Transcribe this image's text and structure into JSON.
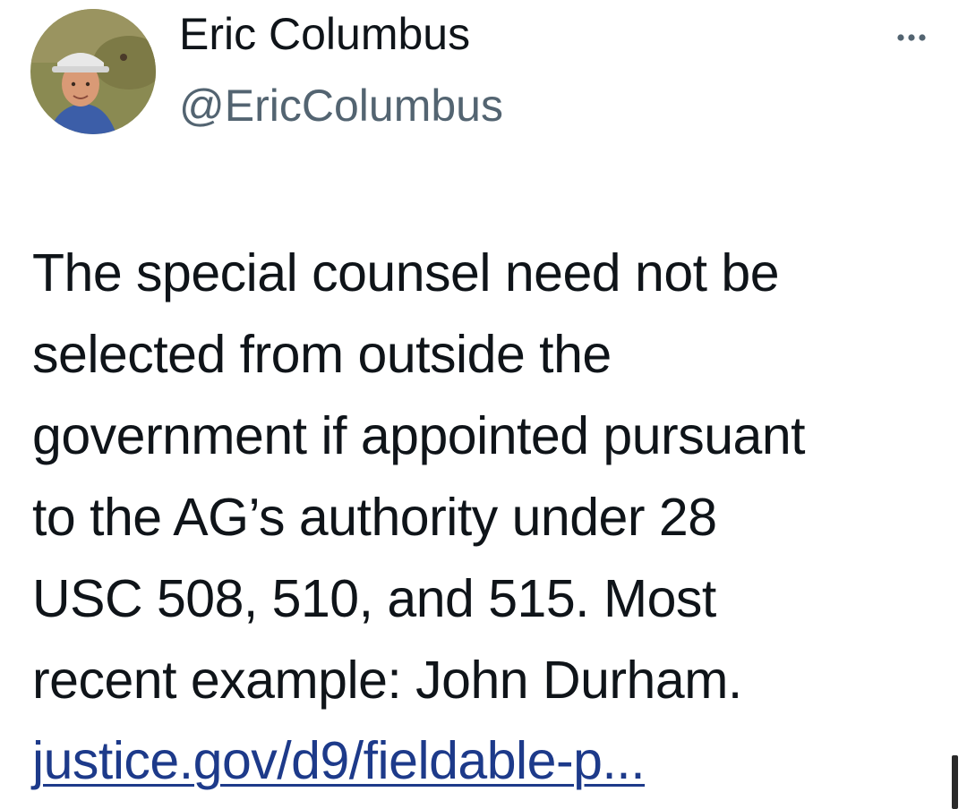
{
  "author": {
    "display_name": "Eric Columbus",
    "handle": "@EricColumbus",
    "avatar_icon": "profile-photo"
  },
  "menu": {
    "icon": "more-horizontal-icon"
  },
  "tweet": {
    "text_lines": [
      "The special counsel need not be",
      "selected from outside the",
      "government if appointed pursuant",
      "to the AG’s authority under 28",
      "USC 508, 510, and 515. Most",
      "recent example: John Durham."
    ],
    "link_text": "justice.gov/d9/fieldable-p...",
    "link_color": "#1d3a8a"
  },
  "colors": {
    "text": "#0f1419",
    "secondary_text": "#536471",
    "background": "#ffffff"
  }
}
